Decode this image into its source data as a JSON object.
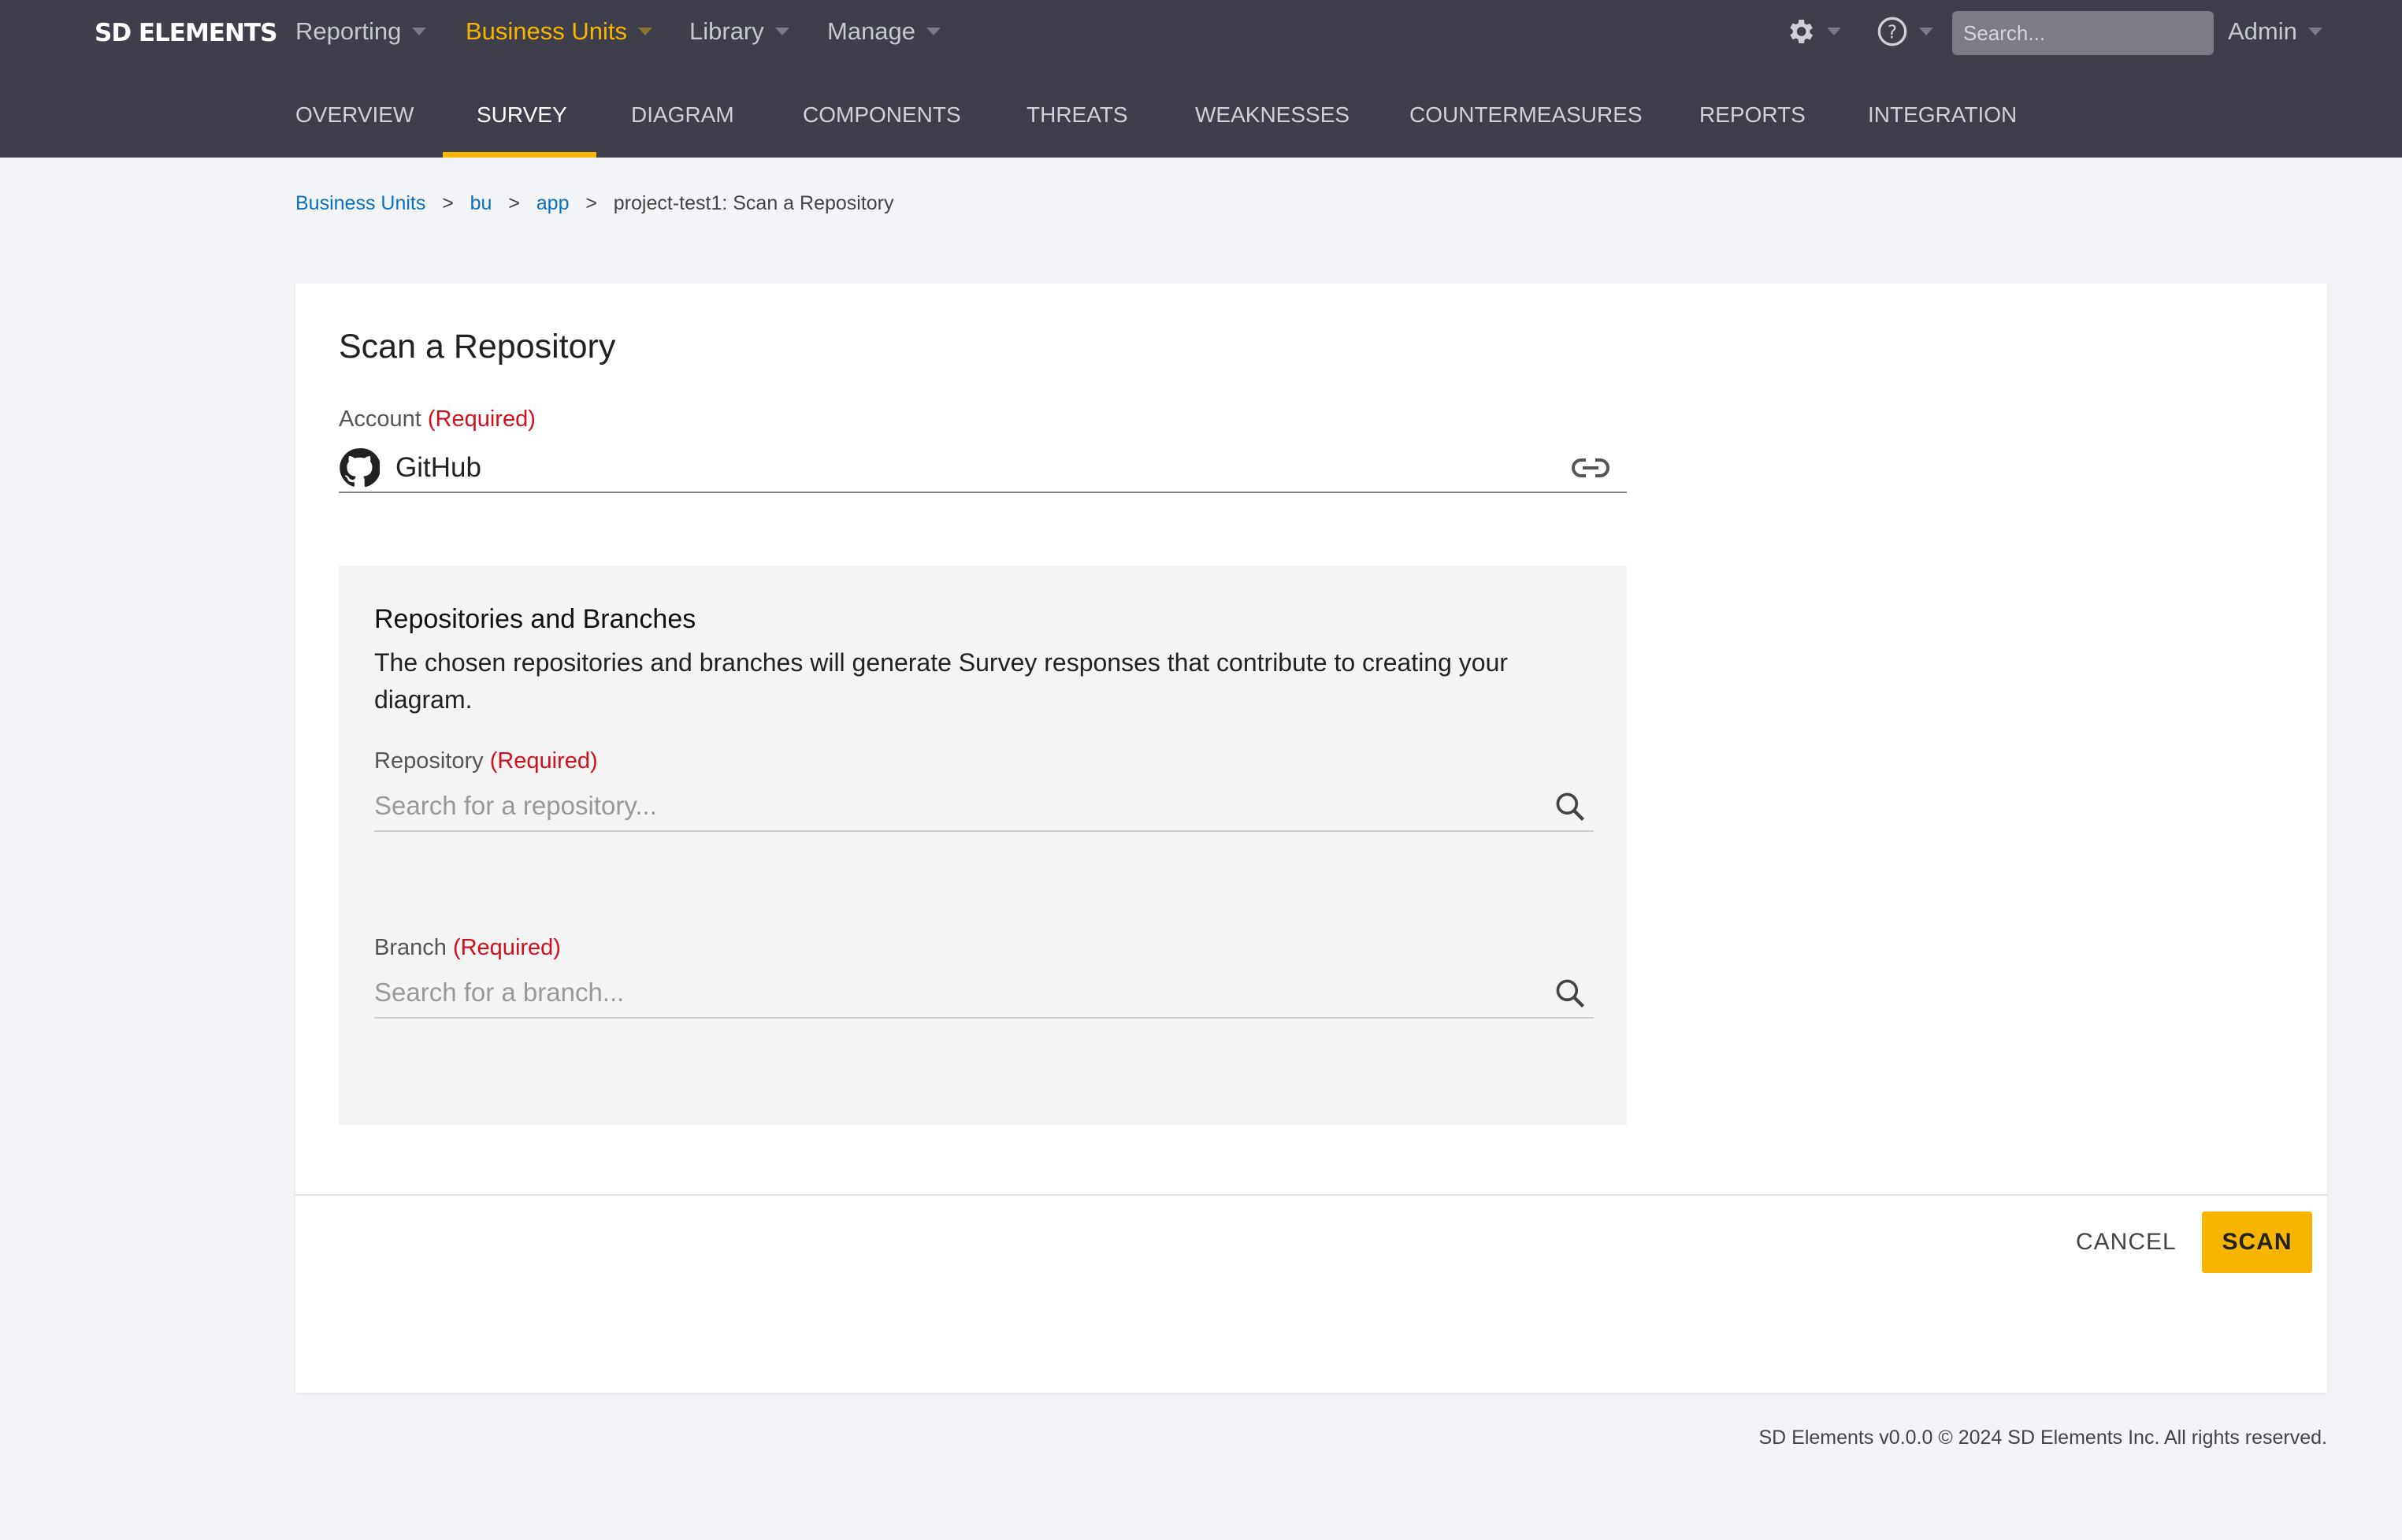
{
  "header": {
    "logo": "SD ELEMENTS",
    "nav": [
      "Reporting",
      "Business Units",
      "Library",
      "Manage"
    ],
    "search_placeholder": "Search...",
    "user": "Admin"
  },
  "tabs": [
    "OVERVIEW",
    "SURVEY",
    "DIAGRAM",
    "COMPONENTS",
    "THREATS",
    "WEAKNESSES",
    "COUNTERMEASURES",
    "REPORTS",
    "INTEGRATION"
  ],
  "breadcrumb": {
    "items": [
      "Business Units",
      "bu",
      "app"
    ],
    "current": "project-test1: Scan a Repository",
    "separator": ">"
  },
  "form": {
    "title": "Scan a Repository",
    "account_label": "Account",
    "required": "(Required)",
    "account_value": "GitHub",
    "section_title": "Repositories and Branches",
    "section_desc": "The chosen repositories and branches will generate Survey responses that contribute to creating your diagram.",
    "repo_label": "Repository",
    "repo_placeholder": "Search for a repository...",
    "branch_label": "Branch",
    "branch_placeholder": "Search for a branch...",
    "cancel": "CANCEL",
    "scan": "SCAN"
  },
  "footer": "SD Elements v0.0.0 © 2024 SD Elements Inc. All rights reserved.",
  "colors": {
    "accent": "#f7b500",
    "header": "#3f3f4b",
    "link": "#0a6fc2",
    "required": "#d0101b"
  }
}
